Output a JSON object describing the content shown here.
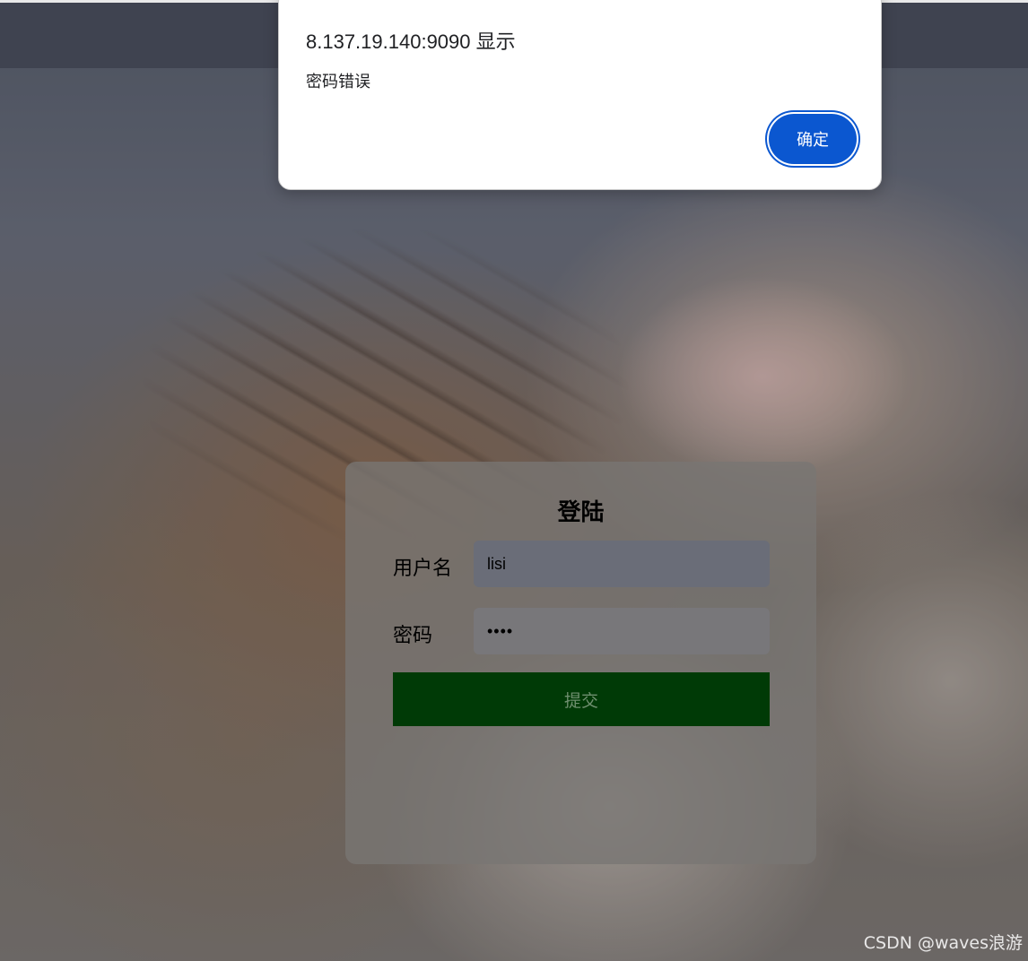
{
  "alert": {
    "origin_text": "8.137.19.140:9090 显示",
    "message": "密码错误",
    "ok_label": "确定",
    "accent_color": "#0b57d0"
  },
  "login": {
    "title": "登陆",
    "username_label": "用户名",
    "username_value": "lisi",
    "password_label": "密码",
    "password_value": "••••",
    "submit_label": "提交",
    "submit_color": "#003a06"
  },
  "watermark": {
    "text": "CSDN @waves浪游"
  }
}
